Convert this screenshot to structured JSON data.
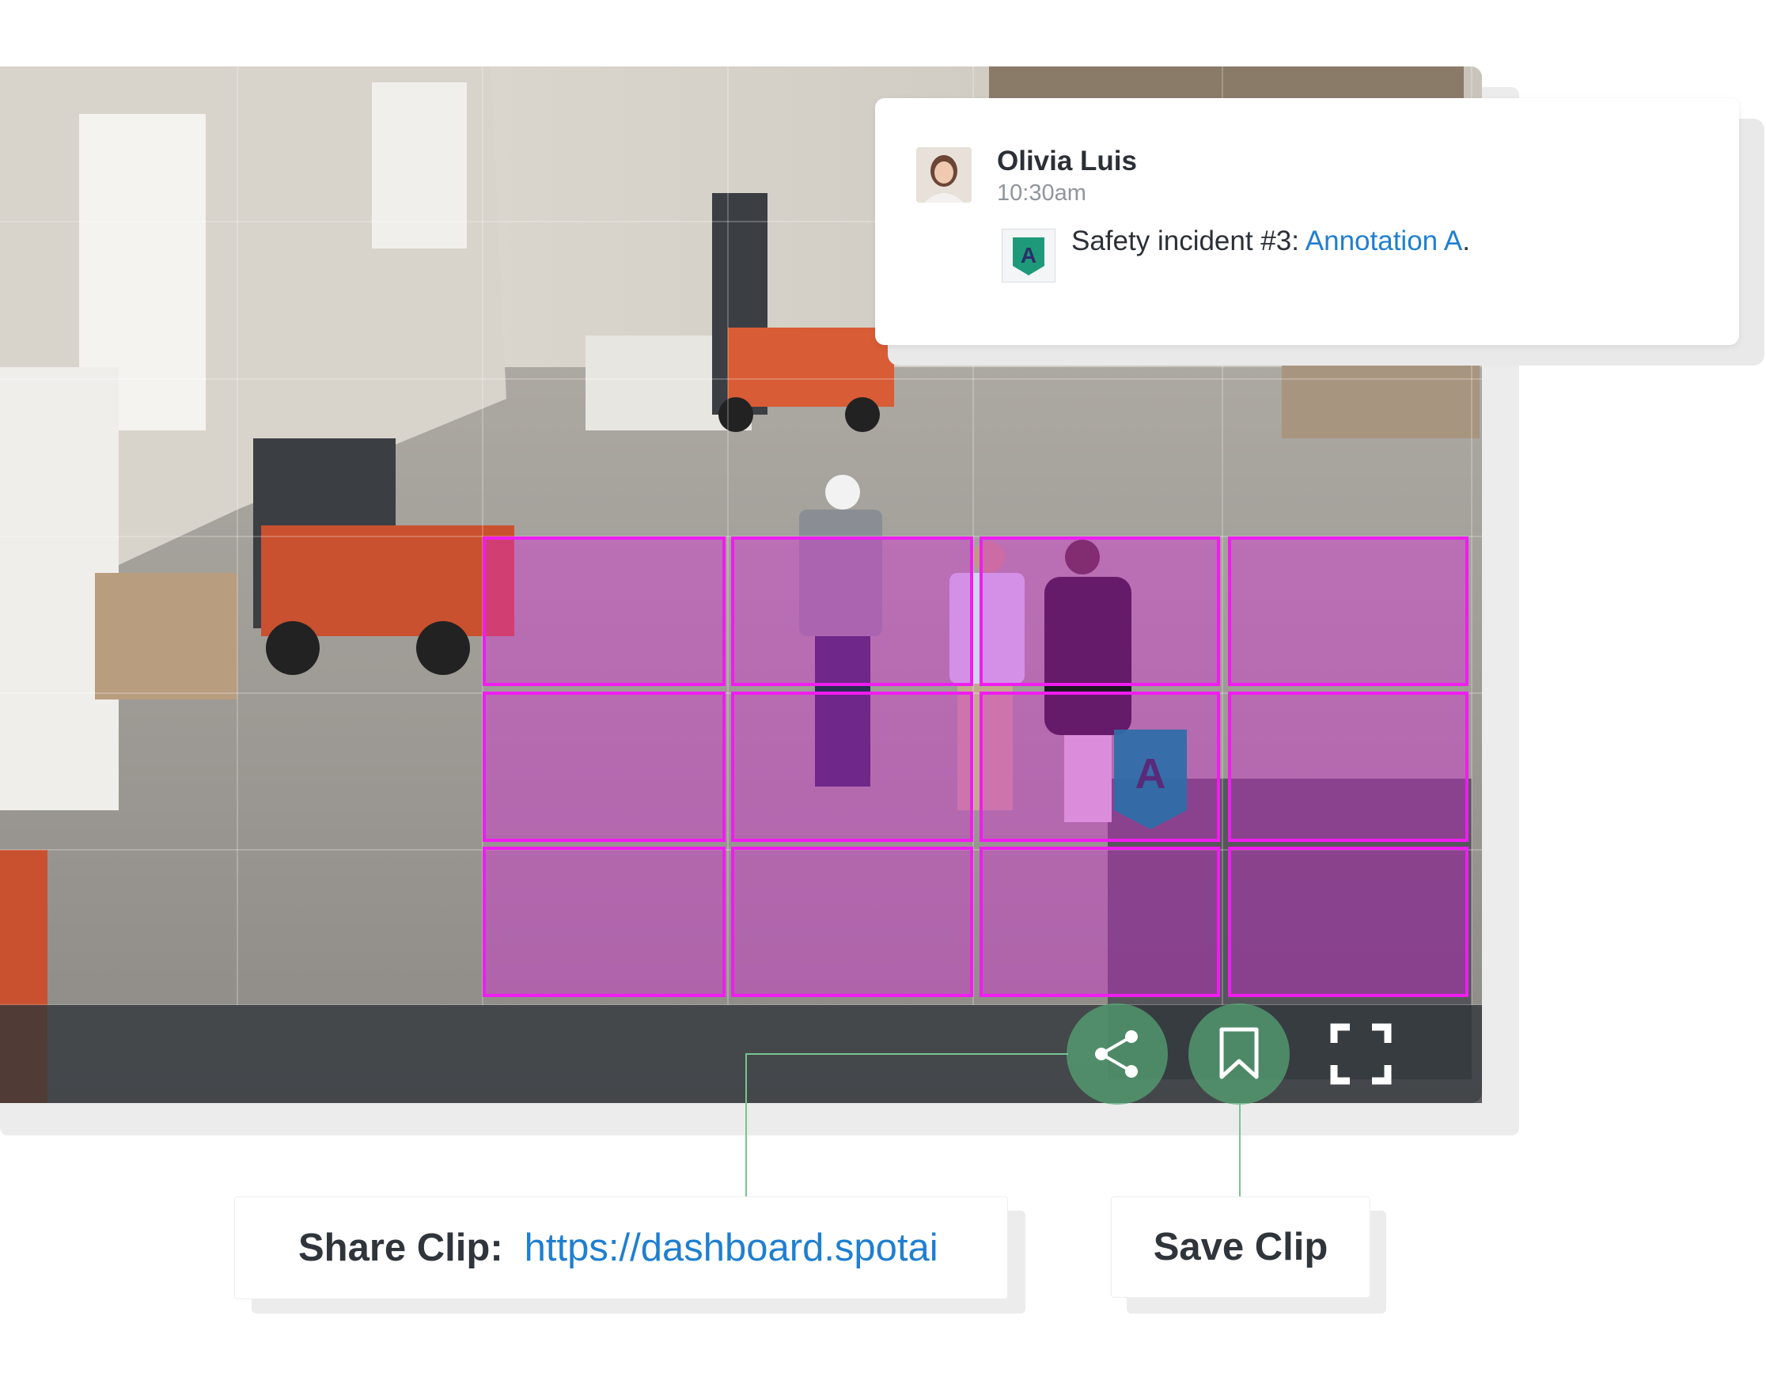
{
  "comment": {
    "user_name": "Olivia Luis",
    "time": "10:30am",
    "badge_letter": "A",
    "text_prefix": "Safety incident #3: ",
    "link_text": "Annotation A",
    "text_suffix": "."
  },
  "annotation_marker": {
    "letter": "A"
  },
  "share_clip": {
    "label": "Share Clip:",
    "url": "https://dashboard.spotai"
  },
  "save_clip": {
    "label": "Save Clip"
  },
  "icons": {
    "share": "share-icon",
    "bookmark": "bookmark-icon",
    "fullscreen": "fullscreen-icon"
  },
  "colors": {
    "zone_highlight": "#e020e0",
    "accent_green": "#56a876",
    "link_blue": "#1f7fd0",
    "marker_blue": "#2d6fa8",
    "badge_teal": "#1e9a7a"
  }
}
